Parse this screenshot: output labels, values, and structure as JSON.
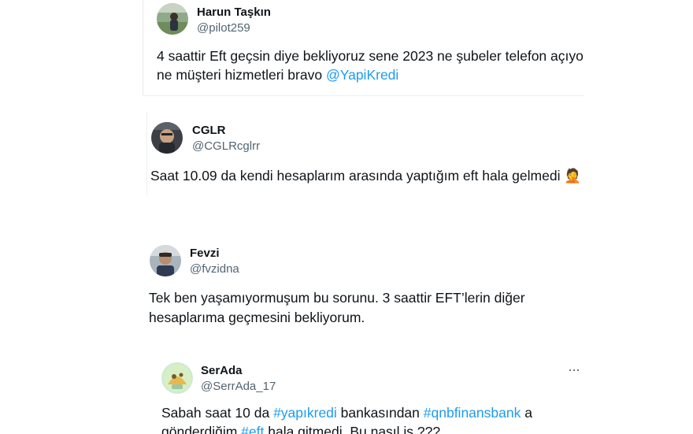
{
  "tweets": [
    {
      "name": "Harun Taşkın",
      "handle": "@pilot259",
      "text1": "4 saattir Eft geçsin diye bekliyoruz sene 2023 ne şubeler telefon açıyo",
      "text2_pre": "ne müşteri hizmetleri bravo ",
      "text2_mention": "@YapiKredi"
    },
    {
      "name": "CGLR",
      "handle": "@CGLRcglrr",
      "text1": "Saat 10.09 da kendi hesaplarım arasında yaptığım eft hala gelmedi",
      "emoji": "🤦"
    },
    {
      "name": "Fevzi",
      "handle": "@fvzidna",
      "text1": "Tek ben yaşamıyormuşum bu sorunu. 3 saattir EFT’lerin diğer",
      "text2": "hesaplarıma geçmesini bekliyorum."
    },
    {
      "name": "SerAda",
      "handle": "@SerrAda_17",
      "more": "···",
      "text1_a": "Sabah saat 10 da ",
      "text1_tag1": "#yapıkredi",
      "text1_b": " bankasından ",
      "text1_tag2": "#qnbfinansbank",
      "text1_c": " a",
      "text2_a": "gönderdiğim ",
      "text2_tag": "#eft",
      "text2_b": " hala gitmedi. Bu nasıl iş ???"
    }
  ],
  "colors": {
    "link": "#1d9bf0",
    "text": "#0f1419",
    "secondary": "#536471"
  }
}
